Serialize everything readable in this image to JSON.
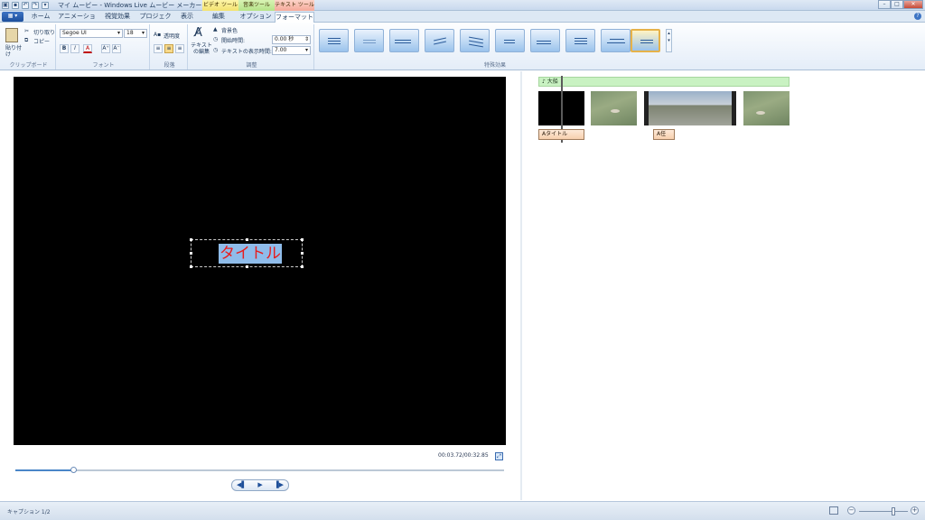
{
  "window": {
    "title": "マイ ムービー - Windows Live ムービー メーカー",
    "context_video": "ビデオ ツール",
    "context_music": "音楽ツール",
    "context_text": "テキスト ツール",
    "minimize": "–",
    "maximize": "□",
    "close": "✕"
  },
  "tabs": [
    "ホーム",
    "アニメーション",
    "視覚効果",
    "プロジェクト",
    "表示",
    "編集",
    "オプション",
    "フォーマット"
  ],
  "active_tab": "フォーマット",
  "ribbon": {
    "clipboard": {
      "paste": "貼り付け",
      "cut": "切り取り",
      "copy": "コピー",
      "label": "クリップボード"
    },
    "font": {
      "family": "Segoe UI",
      "size": "18",
      "label": "フォント",
      "bold": "B",
      "italic": "I",
      "color": "A",
      "grow": "A⁺",
      "shrink": "A⁻"
    },
    "paragraph": {
      "transparency": "透明度",
      "label": "段落"
    },
    "adjust": {
      "edit_text": "テキストの編集",
      "bg_color": "背景色",
      "start_time_label": "開始時間:",
      "start_time_value": "0.00 秒",
      "duration_label": "テキストの表示時間:",
      "duration_value": "7.00",
      "label": "調整"
    },
    "effects": {
      "label": "特殊効果"
    }
  },
  "preview": {
    "caption_text": "タイトル",
    "timecode": "00:03.72/00:32.85",
    "seek_progress": 0.118
  },
  "playback": {
    "prev": "◀▌",
    "play": "▶",
    "next": "▐▶"
  },
  "storyboard": {
    "music_label": "♪ 大船",
    "caption_tags": [
      "Aタイトル",
      "A任"
    ]
  },
  "status": {
    "caption": "キャプション 1/2",
    "zoom_minus": "−",
    "zoom_plus": "+",
    "zoom_level": 0.7
  },
  "colors": {
    "caption_text": "#e81c1c",
    "caption_highlight": "#8fbcea",
    "music_bar": "#c9f2c2",
    "accent": "#1d4f9c"
  }
}
